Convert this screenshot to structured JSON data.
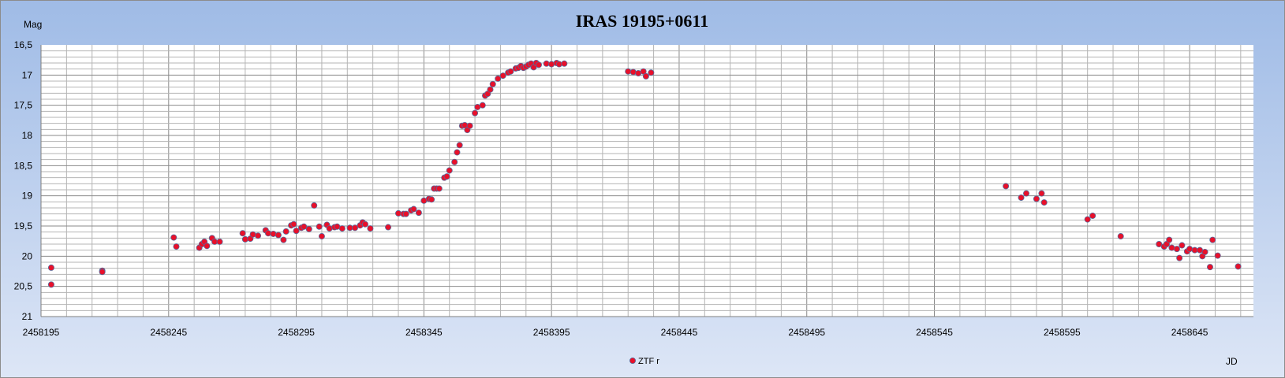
{
  "chart_data": {
    "type": "scatter",
    "title": "IRAS 19195+0611",
    "xlabel": "JD",
    "ylabel": "Mag",
    "xlim": [
      2458195,
      2458670
    ],
    "ylim": [
      16.5,
      21
    ],
    "y_inverted": true,
    "x_ticks": [
      2458195,
      2458245,
      2458295,
      2458345,
      2458395,
      2458445,
      2458495,
      2458545,
      2458595,
      2458645
    ],
    "x_tick_labels": [
      "2458195",
      "2458245",
      "2458295",
      "2458345",
      "2458395",
      "2458445",
      "2458495",
      "2458545",
      "2458595",
      "2458645"
    ],
    "y_ticks": [
      16.5,
      17,
      17.5,
      18,
      18.5,
      19,
      19.5,
      20,
      20.5,
      21
    ],
    "y_tick_labels": [
      "16,5",
      "17",
      "17,5",
      "18",
      "18,5",
      "19",
      "19,5",
      "20",
      "20,5",
      "21"
    ],
    "grid": true,
    "legend_position": "bottom-center",
    "colors": {
      "marker_fill": "#e8102a",
      "marker_stroke": "#5a6a9a",
      "plot_bg": "#ffffff",
      "grid": "#b4b4b4",
      "grid_major": "#8a8a8a",
      "bg_top": "#9fbbe6",
      "bg_bottom": "#dde6f6"
    },
    "series": [
      {
        "name": "ZTF r",
        "points": [
          [
            2458199,
            20.19
          ],
          [
            2458199,
            20.47
          ],
          [
            2458219,
            20.24
          ],
          [
            2458219,
            20.26
          ],
          [
            2458247,
            19.69
          ],
          [
            2458248,
            19.84
          ],
          [
            2458257,
            19.86
          ],
          [
            2458258,
            19.8
          ],
          [
            2458259,
            19.76
          ],
          [
            2458260,
            19.83
          ],
          [
            2458262,
            19.7
          ],
          [
            2458263,
            19.76
          ],
          [
            2458265,
            19.76
          ],
          [
            2458274,
            19.62
          ],
          [
            2458275,
            19.72
          ],
          [
            2458277,
            19.71
          ],
          [
            2458278,
            19.64
          ],
          [
            2458280,
            19.66
          ],
          [
            2458283,
            19.57
          ],
          [
            2458284,
            19.62
          ],
          [
            2458286,
            19.63
          ],
          [
            2458288,
            19.65
          ],
          [
            2458290,
            19.73
          ],
          [
            2458291,
            19.59
          ],
          [
            2458293,
            19.49
          ],
          [
            2458294,
            19.47
          ],
          [
            2458295,
            19.58
          ],
          [
            2458297,
            19.53
          ],
          [
            2458298,
            19.51
          ],
          [
            2458300,
            19.55
          ],
          [
            2458302,
            19.16
          ],
          [
            2458304,
            19.51
          ],
          [
            2458305,
            19.67
          ],
          [
            2458307,
            19.48
          ],
          [
            2458308,
            19.54
          ],
          [
            2458310,
            19.52
          ],
          [
            2458311,
            19.51
          ],
          [
            2458313,
            19.54
          ],
          [
            2458316,
            19.53
          ],
          [
            2458318,
            19.53
          ],
          [
            2458320,
            19.49
          ],
          [
            2458321,
            19.44
          ],
          [
            2458322,
            19.47
          ],
          [
            2458324,
            19.54
          ],
          [
            2458331,
            19.52
          ],
          [
            2458335,
            19.29
          ],
          [
            2458337,
            19.3
          ],
          [
            2458338,
            19.3
          ],
          [
            2458340,
            19.24
          ],
          [
            2458341,
            19.22
          ],
          [
            2458343,
            19.28
          ],
          [
            2458345,
            19.08
          ],
          [
            2458347,
            19.05
          ],
          [
            2458348,
            19.06
          ],
          [
            2458349,
            18.88
          ],
          [
            2458350,
            18.88
          ],
          [
            2458351,
            18.88
          ],
          [
            2458353,
            18.7
          ],
          [
            2458354,
            18.68
          ],
          [
            2458355,
            18.58
          ],
          [
            2458357,
            18.44
          ],
          [
            2458358,
            18.28
          ],
          [
            2458359,
            18.16
          ],
          [
            2458360,
            17.84
          ],
          [
            2458361,
            17.83
          ],
          [
            2458362,
            17.91
          ],
          [
            2458363,
            17.84
          ],
          [
            2458365,
            17.63
          ],
          [
            2458366,
            17.53
          ],
          [
            2458368,
            17.5
          ],
          [
            2458369,
            17.34
          ],
          [
            2458370,
            17.31
          ],
          [
            2458371,
            17.24
          ],
          [
            2458372,
            17.15
          ],
          [
            2458374,
            17.06
          ],
          [
            2458376,
            17.01
          ],
          [
            2458378,
            16.96
          ],
          [
            2458379,
            16.94
          ],
          [
            2458381,
            16.89
          ],
          [
            2458382,
            16.88
          ],
          [
            2458383,
            16.85
          ],
          [
            2458384,
            16.88
          ],
          [
            2458385,
            16.86
          ],
          [
            2458386,
            16.83
          ],
          [
            2458387,
            16.81
          ],
          [
            2458388,
            16.87
          ],
          [
            2458389,
            16.8
          ],
          [
            2458390,
            16.83
          ],
          [
            2458393,
            16.81
          ],
          [
            2458395,
            16.82
          ],
          [
            2458397,
            16.8
          ],
          [
            2458398,
            16.82
          ],
          [
            2458400,
            16.81
          ],
          [
            2458425,
            16.94
          ],
          [
            2458427,
            16.95
          ],
          [
            2458429,
            16.97
          ],
          [
            2458431,
            16.94
          ],
          [
            2458432,
            17.02
          ],
          [
            2458434,
            16.96
          ],
          [
            2458573,
            18.84
          ],
          [
            2458579,
            19.03
          ],
          [
            2458581,
            18.96
          ],
          [
            2458585,
            19.05
          ],
          [
            2458587,
            18.96
          ],
          [
            2458588,
            19.11
          ],
          [
            2458605,
            19.39
          ],
          [
            2458607,
            19.33
          ],
          [
            2458618,
            19.67
          ],
          [
            2458633,
            19.8
          ],
          [
            2458635,
            19.84
          ],
          [
            2458636,
            19.8
          ],
          [
            2458637,
            19.73
          ],
          [
            2458638,
            19.86
          ],
          [
            2458640,
            19.88
          ],
          [
            2458641,
            20.03
          ],
          [
            2458642,
            19.82
          ],
          [
            2458644,
            19.92
          ],
          [
            2458645,
            19.88
          ],
          [
            2458647,
            19.9
          ],
          [
            2458649,
            19.9
          ],
          [
            2458650,
            20.0
          ],
          [
            2458651,
            19.93
          ],
          [
            2458653,
            20.18
          ],
          [
            2458654,
            19.73
          ],
          [
            2458656,
            19.99
          ],
          [
            2458664,
            20.17
          ]
        ]
      }
    ]
  }
}
